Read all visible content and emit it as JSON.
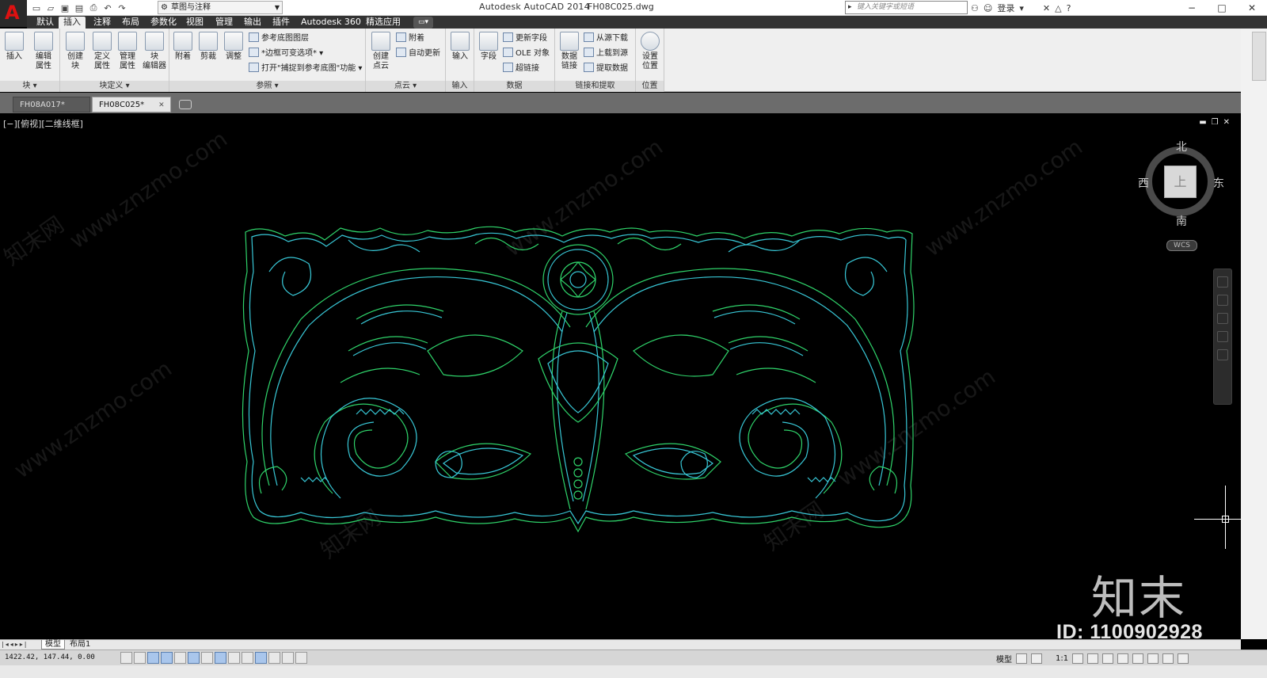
{
  "titlebar": {
    "app_name": "Autodesk AutoCAD 2014",
    "file_name": "FH08C025.dwg",
    "workspace": "草图与注释",
    "search_placeholder": "键入关键字或短语",
    "login": "登录"
  },
  "ribbon_tabs": [
    "默认",
    "插入",
    "注释",
    "布局",
    "参数化",
    "视图",
    "管理",
    "输出",
    "插件",
    "Autodesk 360",
    "精选应用"
  ],
  "ribbon": {
    "block": {
      "title": "块",
      "insert": "插入",
      "edit_attr_1": "编辑",
      "edit_attr_2": "属性"
    },
    "block_def": {
      "title": "块定义",
      "create_1": "创建",
      "create_2": "块",
      "define_1": "定义",
      "define_2": "属性",
      "manage_1": "管理",
      "manage_2": "属性",
      "editor_1": "块",
      "editor_2": "编辑器"
    },
    "reference": {
      "title": "参照",
      "attach": "附着",
      "clip": "剪裁",
      "adjust": "调整",
      "underlay_layers": "参考底图图层",
      "frames": "*边框可变选项*",
      "snap": "打开\"捕捉到参考底图\"功能"
    },
    "point_cloud": {
      "title": "点云",
      "create_1": "创建",
      "create_2": "点云",
      "attach": "附着",
      "autoupdate": "自动更新"
    },
    "import": {
      "title": "输入",
      "import": "输入"
    },
    "data": {
      "title": "数据",
      "field": "字段",
      "update_fields": "更新字段",
      "ole": "OLE 对象",
      "hyperlink": "超链接"
    },
    "linking": {
      "title": "链接和提取",
      "data_link_1": "数据",
      "data_link_2": "链接",
      "download": "从源下载",
      "upload": "上载到源",
      "extract": "提取数据"
    },
    "location": {
      "title": "位置",
      "set_1": "设置",
      "set_2": "位置"
    }
  },
  "file_tabs": [
    {
      "label": "FH08A017*"
    },
    {
      "label": "FH08C025*"
    }
  ],
  "viewport": {
    "label": "[−][俯视][二维线框]"
  },
  "viewcube": {
    "north": "北",
    "south": "南",
    "west": "西",
    "east": "东",
    "face": "上",
    "wcs": "WCS"
  },
  "layout_tabs": [
    "模型",
    "布局1"
  ],
  "status": {
    "coordinates": "1422.42, 147.44, 0.00",
    "model": "模型",
    "scale": "1:1"
  },
  "watermark": {
    "logo": "知末",
    "id": "ID: 1100902928",
    "site": "www.znzmo.com",
    "site_cn": "知末网"
  },
  "colors": {
    "line_green": "#2fd36a",
    "line_cyan": "#38c7d6",
    "canvas_bg": "#000000"
  }
}
